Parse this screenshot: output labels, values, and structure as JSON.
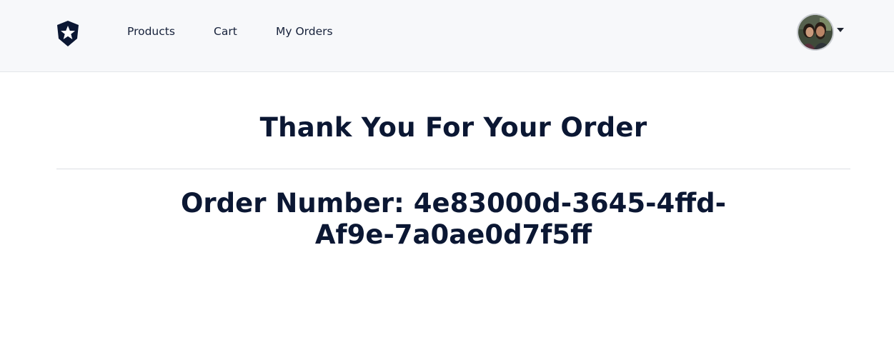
{
  "nav": {
    "logo_icon": "star-shield-icon",
    "links": [
      {
        "label": "Products"
      },
      {
        "label": "Cart"
      },
      {
        "label": "My Orders"
      }
    ],
    "user_menu": {
      "avatar_icon": "user-avatar-photo",
      "dropdown_icon": "caret-down-icon"
    }
  },
  "main": {
    "heading": "Thank You For Your Order",
    "order_number": "Order Number: 4e83000d-3645-4ffd-Af9e-7a0ae0d7f5ff"
  },
  "colors": {
    "navbar_bg": "#f7f8fa",
    "text": "#0b1733",
    "logo": "#0b1733"
  }
}
